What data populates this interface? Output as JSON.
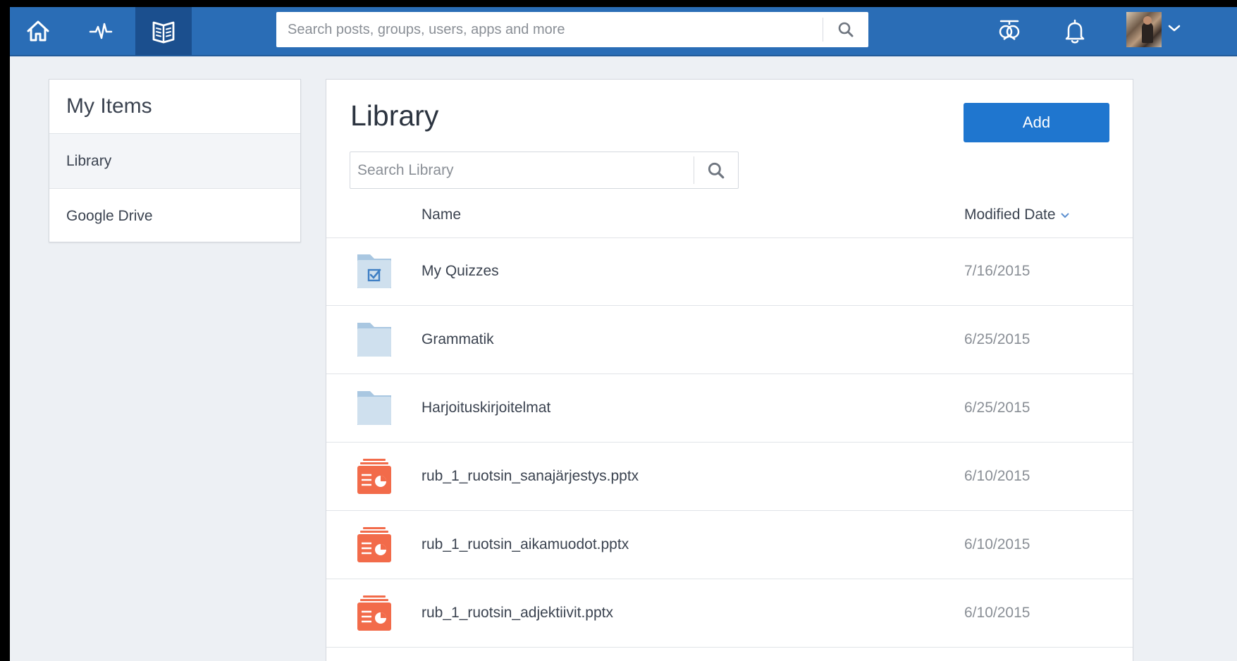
{
  "topnav": {
    "search_placeholder": "Search posts, groups, users, apps and more",
    "nav_icons": [
      "home-icon",
      "activity-icon",
      "backpack-icon"
    ],
    "right_icons": [
      "communities-icon",
      "bell-icon"
    ],
    "brand_color": "#2a6db6"
  },
  "sidebar": {
    "title": "My Items",
    "items": [
      {
        "label": "Library",
        "active": true
      },
      {
        "label": "Google Drive",
        "active": false
      }
    ]
  },
  "library": {
    "title": "Library",
    "add_label": "Add",
    "search_placeholder": "Search Library",
    "columns": {
      "name": "Name",
      "date": "Modified Date"
    },
    "rows": [
      {
        "name": "My Quizzes",
        "date": "7/16/2015",
        "type": "quiz-folder"
      },
      {
        "name": "Grammatik",
        "date": "6/25/2015",
        "type": "folder"
      },
      {
        "name": "Harjoituskirjoitelmat",
        "date": "6/25/2015",
        "type": "folder"
      },
      {
        "name": "rub_1_ruotsin_sanajärjestys.pptx",
        "date": "6/10/2015",
        "type": "pptx"
      },
      {
        "name": "rub_1_ruotsin_aikamuodot.pptx",
        "date": "6/10/2015",
        "type": "pptx"
      },
      {
        "name": "rub_1_ruotsin_adjektiivit.pptx",
        "date": "6/10/2015",
        "type": "pptx"
      }
    ],
    "accent_color": "#1f76cf",
    "pptx_color": "#f26b4a",
    "folder_color": "#cfe0ee"
  }
}
